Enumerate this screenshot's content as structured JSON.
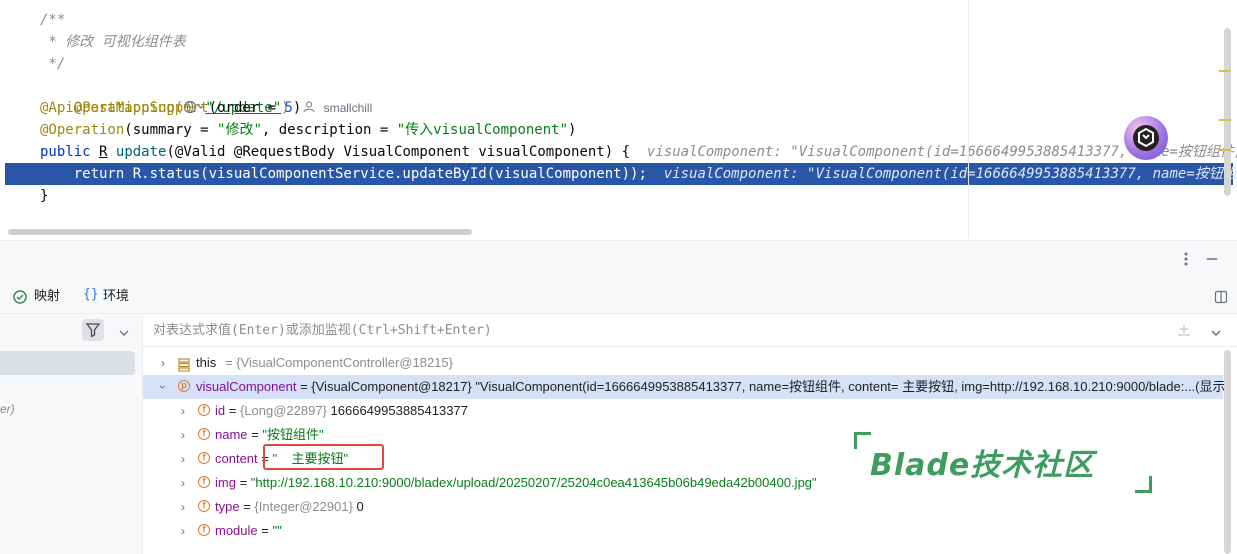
{
  "editor": {
    "lines": {
      "l1": "/**",
      "l2": " * 修改 可视化组件表",
      "l3": " */",
      "l4_ann": "@PostMapping(",
      "l4_str": "\"/update\"",
      "l4_close": ")",
      "l4_author": "smallchill",
      "l5_ann": "@ApiOperationSupport",
      "l5_arg": "(order = ",
      "l5_num": "5",
      "l5_close": ")",
      "l6_ann": "@Operation",
      "l6_a": "(summary = ",
      "l6_s1": "\"修改\"",
      "l6_b": ", description = ",
      "l6_s2": "\"传入visualComponent\"",
      "l6_close": ")",
      "l7_kw": "public",
      "l7_type": "R",
      "l7_fn": "update",
      "l7_params": "(@Valid @RequestBody VisualComponent visualComponent) {",
      "l7_hint": "visualComponent: \"VisualComponent(id=1666649953885413377, name=按钮组件, conte",
      "l8_code": "    return R.status(visualComponentService.updateById(visualComponent));",
      "l8_hint": "visualComponent: \"VisualComponent(id=1666649953885413377, name=按钮组件, con",
      "l9": "}"
    }
  },
  "debug_tabs": {
    "mapping": "映射",
    "environment": "环境"
  },
  "frames": {
    "hint": "er)"
  },
  "evaluate": {
    "placeholder": "对表达式求值(Enter)或添加监视(Ctrl+Shift+Enter)"
  },
  "variables": [
    {
      "name": "this",
      "value": "= {VisualComponentController@18215}"
    },
    {
      "name": "visualComponent",
      "eq": " = ",
      "ref": "{VisualComponent@18217}",
      "value": " \"VisualComponent(id=1666649953885413377, name=按钮组件, content=    主要按钮, img=http://192.168.10.210:9000/blade:...(显示)"
    },
    {
      "name": "id",
      "eq": " = ",
      "ref": "{Long@22897}",
      "value": " 1666649953885413377"
    },
    {
      "name": "name",
      "eq": " = ",
      "value": "\"按钮组件\""
    },
    {
      "name": "content",
      "eq": " = ",
      "value": "\"    主要按钮\""
    },
    {
      "name": "img",
      "eq": " = ",
      "value": "\"http://192.168.10.210:9000/bladex/upload/20250207/25204c0ea413645b06b49eda42b00400.jpg\""
    },
    {
      "name": "type",
      "eq": " = ",
      "ref": "{Integer@22901}",
      "value": " 0"
    },
    {
      "name": "module",
      "eq": " = ",
      "value": "\"\""
    }
  ],
  "watermark": {
    "text": "Blade技术社区"
  },
  "colors": {
    "highlight": "#2a56a8",
    "selection": "#d5e1f7",
    "annotation_box": "#e0483b",
    "watermark": "#3d9c5e"
  }
}
